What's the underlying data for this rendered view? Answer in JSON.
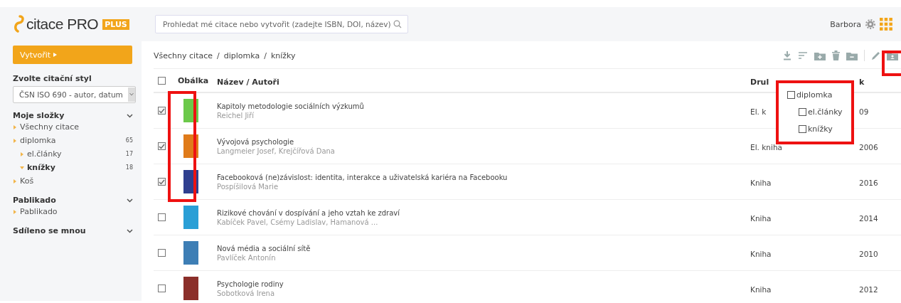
{
  "header": {
    "logo": "citace PRO",
    "badge": "PLUS",
    "search": {
      "placeholder": "Prohledat mé citace nebo vytvořit (zadejte ISBN, DOI, název)"
    },
    "user": "Barbora"
  },
  "sidebar": {
    "create_button": "Vytvořit",
    "style_label": "Zvolte citační styl",
    "style_select": "ČSN ISO 690 - autor, datum",
    "sections": [
      {
        "title": "Moje složky",
        "items": [
          {
            "label": "Všechny citace",
            "selected": false,
            "expanded": false
          },
          {
            "label": "diplomka",
            "count": "65",
            "selected": false,
            "expanded": false,
            "children": [
              {
                "label": "el.články",
                "count": "17",
                "selected": false,
                "expanded": false
              },
              {
                "label": "knížky",
                "count": "18",
                "selected": true,
                "expanded": true
              }
            ]
          },
          {
            "label": "Koš",
            "selected": false,
            "expanded": false
          }
        ]
      },
      {
        "title": "Pablikado",
        "items": [
          {
            "label": "Pablikado",
            "selected": false,
            "expanded": false
          }
        ]
      },
      {
        "title": "Sdíleno se mnou"
      }
    ]
  },
  "breadcrumb": {
    "items": [
      "Všechny citace",
      "diplomka",
      "knížky"
    ],
    "separator": "/"
  },
  "table": {
    "select_all_checked": false,
    "columns": [
      "Obálka",
      "Název / Autoři",
      "Drul",
      "k"
    ],
    "rows": [
      {
        "checked": true,
        "color": "#6cc94a",
        "title": "Kapitoly metodologie sociálních výzkumů",
        "authors": "Reichel Jiří",
        "type": "El. k",
        "year": "09"
      },
      {
        "checked": true,
        "color": "#e07b1a",
        "title": "Vývojová psychologie",
        "authors": "Langmeier Josef, Krejčířová Dana",
        "type": "El. kniha",
        "year": "2006"
      },
      {
        "checked": true,
        "color": "#2f3f8f",
        "title": "Facebooková (ne)závislost: identita, interakce a uživatelská kariéra na Facebooku",
        "authors": "Pospíšilová Marie",
        "type": "Kniha",
        "year": "2016"
      },
      {
        "checked": false,
        "color": "#2a9fd6",
        "title": "Rizikové chování v dospívání a jeho vztah ke zdraví",
        "authors": "Kabíček Pavel, Csémy Ladislav, Hamanová ...",
        "type": "Kniha",
        "year": "2014"
      },
      {
        "checked": false,
        "color": "#3d7eb5",
        "title": "Nová média a sociální sítě",
        "authors": "Pavlíček Antonín",
        "type": "Kniha",
        "year": "2010"
      },
      {
        "checked": false,
        "color": "#8b2f2a",
        "title": "Psychologie rodiny",
        "authors": "Sobotková Irena",
        "type": "Kniha",
        "year": "2012"
      }
    ]
  },
  "folder_popup": {
    "items": [
      {
        "label": "diplomka",
        "checked": false,
        "children": [
          {
            "label": "el.články",
            "checked": false
          },
          {
            "label": "knížky",
            "checked": false
          }
        ]
      }
    ]
  }
}
